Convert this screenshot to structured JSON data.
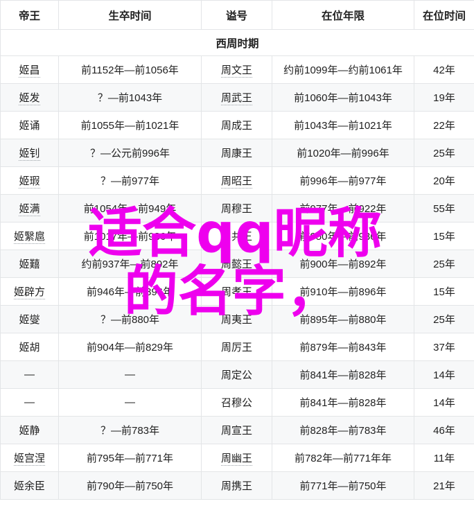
{
  "table": {
    "headers": [
      "帝王",
      "生卒时间",
      "谥号",
      "在位年限",
      "在位时间"
    ],
    "section_title": "西周时期",
    "rows": [
      {
        "name": "姬昌",
        "life": "前1152年—前1056年",
        "posthumous": "周文王",
        "reign_period": "约前1099年—约前1061年",
        "reign_years": "42年"
      },
      {
        "name": "姬发",
        "life": "？—前1043年",
        "posthumous": "周武王",
        "reign_period": "前1060年—前1043年",
        "reign_years": "19年"
      },
      {
        "name": "姬诵",
        "life": "前1055年—前1021年",
        "posthumous": "周成王",
        "reign_period": "前1043年—前1021年",
        "reign_years": "22年"
      },
      {
        "name": "姬钊",
        "life": "？—公元前996年",
        "posthumous": "周康王",
        "reign_period": "前1020年—前996年",
        "reign_years": "25年"
      },
      {
        "name": "姬瑕",
        "life": "？—前977年",
        "posthumous": "周昭王",
        "reign_period": "前996年—前977年",
        "reign_years": "20年"
      },
      {
        "name": "姬满",
        "life": "前1054年—前949年",
        "posthumous": "周穆王",
        "reign_period": "前977年—前922年",
        "reign_years": "55年"
      },
      {
        "name": "姬繄扈",
        "life": "前1017年—前936年",
        "posthumous": "周共王",
        "reign_period": "前950年—前936年",
        "reign_years": "15年"
      },
      {
        "name": "姬囏",
        "life": "约前937年—前892年",
        "posthumous": "周懿王",
        "reign_period": "前900年—前892年",
        "reign_years": "25年"
      },
      {
        "name": "姬辟方",
        "life": "前946年—前896年",
        "posthumous": "周孝王",
        "reign_period": "前910年—前896年",
        "reign_years": "15年"
      },
      {
        "name": "姬燮",
        "life": "？—前880年",
        "posthumous": "周夷王",
        "reign_period": "前895年—前880年",
        "reign_years": "25年"
      },
      {
        "name": "姬胡",
        "life": "前904年—前829年",
        "posthumous": "周厉王",
        "reign_period": "前879年—前843年",
        "reign_years": "37年"
      },
      {
        "name": "—",
        "life": "—",
        "posthumous": "周定公",
        "reign_period": "前841年—前828年",
        "reign_years": "14年"
      },
      {
        "name": "—",
        "life": "—",
        "posthumous": "召穆公",
        "reign_period": "前841年—前828年",
        "reign_years": "14年"
      },
      {
        "name": "姬静",
        "life": "？—前783年",
        "posthumous": "周宣王",
        "reign_period": "前828年—前783年",
        "reign_years": "46年"
      },
      {
        "name": "姬宫涅",
        "life": "前795年—前771年",
        "posthumous": "周幽王",
        "reign_period": "前782年—前771年年",
        "reign_years": "11年"
      },
      {
        "name": "姬余臣",
        "life": "前790年—前750年",
        "posthumous": "周携王",
        "reign_period": "前771年—前750年",
        "reign_years": "21年"
      }
    ]
  },
  "watermark": {
    "line1": "适合qq昵称",
    "line2": "的名字，",
    "color": "#ee00ee"
  }
}
